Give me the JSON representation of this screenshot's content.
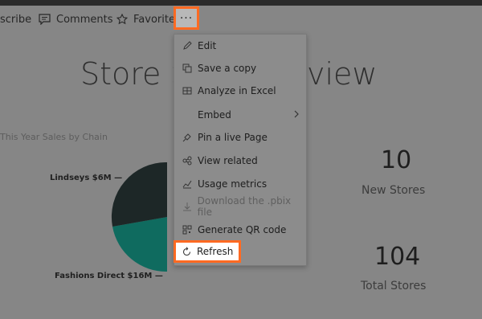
{
  "toolbar": {
    "subscribe_label": "scribe",
    "comments_label": "Comments",
    "favorite_label": "Favorite",
    "more_label": "···"
  },
  "report": {
    "title_part1": "Store Sa",
    "title_part2": "view",
    "chart_label": "This Year Sales by Chain",
    "pie_labels": [
      "Lindseys $6M",
      "Fashions Direct $16M"
    ],
    "kpis": [
      {
        "value": "10",
        "label": "New Stores"
      },
      {
        "value": "104",
        "label": "Total Stores"
      }
    ]
  },
  "menu": {
    "items": [
      {
        "label": "Edit",
        "icon": "pencil-icon"
      },
      {
        "label": "Save a copy",
        "icon": "copy-icon"
      },
      {
        "label": "Analyze in Excel",
        "icon": "excel-icon"
      },
      {
        "label": "Embed",
        "icon": "none",
        "submenu": true
      },
      {
        "label": "Pin a live Page",
        "icon": "pin-icon"
      },
      {
        "label": "View related",
        "icon": "related-icon"
      },
      {
        "label": "Usage metrics",
        "icon": "metrics-icon"
      },
      {
        "label": "Download the .pbix file",
        "icon": "download-icon",
        "disabled": true
      },
      {
        "label": "Generate QR code",
        "icon": "qr-icon"
      },
      {
        "label": "Refresh",
        "icon": "refresh-icon"
      }
    ]
  },
  "colors": {
    "highlight": "#ff6a22",
    "pie_dark": "#1d2727",
    "pie_teal": "#0f6b5f"
  }
}
